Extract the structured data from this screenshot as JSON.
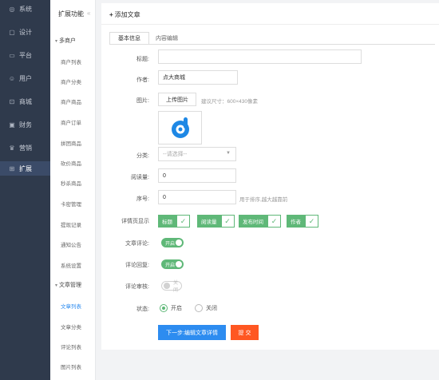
{
  "nav1": {
    "items": [
      {
        "label": "系统",
        "icon": "gear-icon"
      },
      {
        "label": "设计",
        "icon": "monitor-icon"
      },
      {
        "label": "平台",
        "icon": "screen-icon"
      },
      {
        "label": "用户",
        "icon": "user-icon"
      },
      {
        "label": "商城",
        "icon": "cart-icon"
      },
      {
        "label": "财务",
        "icon": "wallet-icon"
      },
      {
        "label": "营销",
        "icon": "building-icon"
      },
      {
        "label": "扩展",
        "icon": "grid-icon"
      }
    ],
    "active_index": 7
  },
  "nav2": {
    "title": "扩展功能",
    "collapse_glyph": "«",
    "group1": "多商户",
    "group1_items": [
      "商户列表",
      "商户分类",
      "商户商品",
      "商户订单",
      "拼团商品",
      "砍价商品",
      "秒杀商品",
      "卡密管理",
      "提现记录",
      "通知公告",
      "系统设置"
    ],
    "group2": "文章管理",
    "group2_items": [
      "文章列表",
      "文章分类",
      "评论列表",
      "图片列表"
    ],
    "active_item": "文章列表"
  },
  "page": {
    "title": "添加文章",
    "tabs": [
      "基本信息",
      "内容编辑"
    ]
  },
  "form": {
    "title_label": "标题:",
    "title_value": "",
    "author_label": "作者:",
    "author_value": "点大商城",
    "image_label": "图片:",
    "upload_label": "上传图片",
    "image_hint": "建议尺寸：600×430像素",
    "category_label": "分类:",
    "category_placeholder": "--请选择--",
    "reads_label": "阅读量:",
    "reads_value": "0",
    "order_label": "序号:",
    "order_value": "0",
    "order_hint": "用于排序,越大越靠前",
    "detail_label": "详情页显示",
    "detail_options": [
      "标题",
      "阅读量",
      "发布时间",
      "作者"
    ],
    "comment_label": "文章评论:",
    "comment_state": "开启",
    "reply_label": "评论回复:",
    "reply_state": "开启",
    "audit_label": "评论审核:",
    "audit_state": "关闭",
    "status_label": "状态:",
    "status_on": "开启",
    "status_off": "关闭",
    "next_button": "下一步:编辑文章详情",
    "submit_button": "提 交"
  },
  "colors": {
    "sidebar_bg": "#2f3a4c",
    "accent_green": "#5fb878",
    "accent_blue": "#2d8cf0",
    "accent_orange": "#ff5722"
  }
}
